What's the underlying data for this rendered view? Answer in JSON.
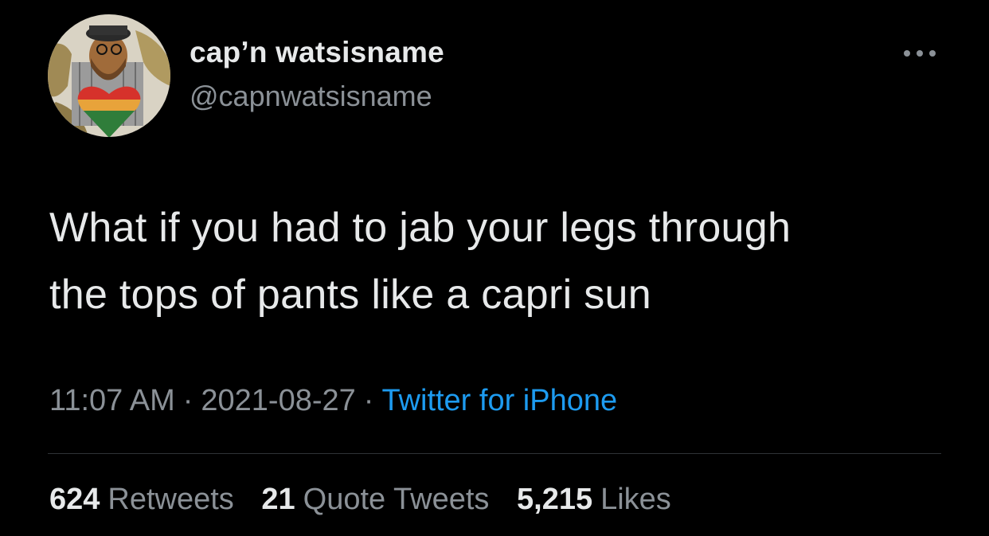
{
  "author": {
    "display_name": "cap’n watsisname",
    "handle": "@capnwatsisname"
  },
  "tweet": {
    "text_line_1": "What if you had to jab your legs through",
    "text_line_2": "the tops of pants like a capri sun",
    "time": "11:07 AM",
    "date": "2021-08-27",
    "separator": "·",
    "source": "Twitter for iPhone"
  },
  "stats": {
    "retweets_count": "624",
    "retweets_label": "Retweets",
    "quotes_count": "21",
    "quotes_label": "Quote Tweets",
    "likes_count": "5,215",
    "likes_label": "Likes"
  },
  "icons": {
    "more": "more-horizontal-icon"
  },
  "colors": {
    "background": "#000000",
    "primary_text": "#e7e9ea",
    "secondary_text": "#8b9197",
    "link": "#1d9bf0",
    "divider": "#2f3336"
  }
}
